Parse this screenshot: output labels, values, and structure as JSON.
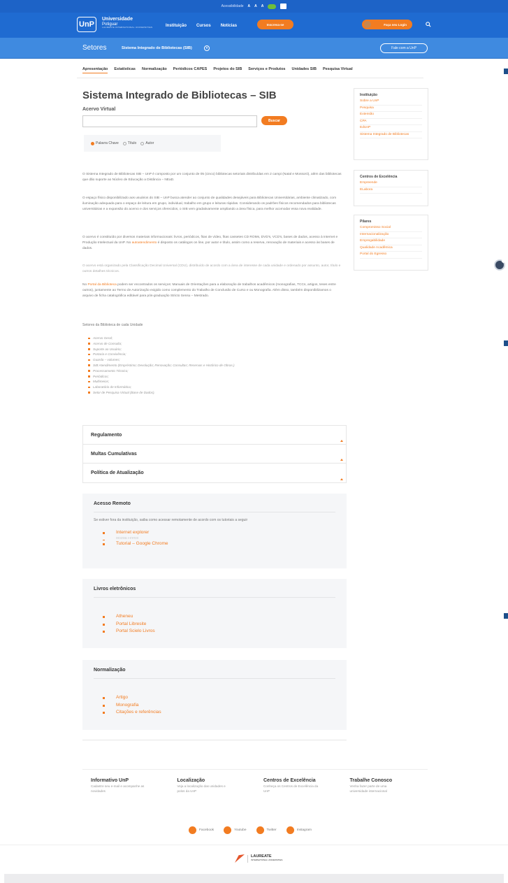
{
  "topbar": {
    "label": "Acessibilidade",
    "a1": "A",
    "a2": "A",
    "a3": "A"
  },
  "header": {
    "logo": "UnP",
    "univ1": "Universidade",
    "univ2": "Potiguar",
    "univ3": "LAUREATE INTERNATIONAL UNIVERSITIES",
    "nav": [
      "Instituição",
      "Cursos",
      "Notícias"
    ],
    "inscreva": "Inscreva-se",
    "login": "Faça seu Login"
  },
  "sectorbar": {
    "setores": "Setores",
    "current": "Sistema Integrado de Bibliotecas (SIB)",
    "fale": "Fale com a UnP"
  },
  "secnav": [
    "Apresentação",
    "Estatísticas",
    "Normalização",
    "Periódicos CAPES",
    "Projetos do SIB",
    "Serviços e Produtos",
    "Unidades SIB",
    "Pesquisa Virtual"
  ],
  "page": {
    "title": "Sistema Integrado de Bibliotecas – SIB",
    "acervo": "Acervo Virtual",
    "buscar": "Buscar",
    "radios": [
      "Palavra Chave",
      "Título",
      "Autor"
    ]
  },
  "sidebar": [
    {
      "title": "Instituição",
      "links": [
        "Sobre a UnP",
        "Pesquisa",
        "Extensão",
        "CPA",
        "EdUnP",
        "Sistema Integrado de Bibliotecas"
      ]
    },
    {
      "title": "Centros de Excelência",
      "links": [
        "Empreende",
        "ELabora"
      ]
    },
    {
      "title": "Pilares",
      "links": [
        "Compromisso Social",
        "Internacionalização",
        "Empregabilidade",
        "Qualidade Acadêmica",
        "Portal do Egresso"
      ]
    }
  ],
  "body": {
    "p1": "O Sistema Integrado de Bibliotecas SIB – UnP é composto por um conjunto de 05 (cinco) bibliotecas setoriais distribuídas em 2 campi (Natal e Mossoró), além das bibliotecas que dão suporte ao Núcleo de Educação a Distância – NEaD.",
    "p2": "O espaço físico disponibilizado aos usuários do SIB – UnP busca atender ao conjunto de qualidades desejáveis para Bibliotecas Universitárias, ambiente climatizado, com iluminação adequada para o espaço de leitura em grupo, individual, trabalho em grupo e leituras rápidas. Considerando os padrões físicos recomendados para bibliotecas universitárias e a expansão do acervo e dos serviços oferecidos, o SIB vem gradativamente ampliando a área física, para melhor acomodar essa nova realidade.",
    "p3a": "O acervo é constituído por diversos materiais informacionais: livros, periódicos, fitas de vídeo, fitas cassetes CD ROMs, DVD's, VCD's, bases de dados, acesso à Internet e Produção Intelectual da UnP. No ",
    "p3link": "autoatendimento",
    "p3b": " é disposto os catálogos on line, por autor e título, assim como a reserva, renovação de materiais e acesso às bases de dados.",
    "p4": "O acervo está organizado pela Classificação Decimal Universal (CDU), distribuído de acordo com a área de interesse de cada unidade e ordenado por assunto, autor, título e outros detalhes técnicos.",
    "p5a": "No ",
    "p5link": "Portal da Biblioteca",
    "p5b": " podem ser encontrados os serviços: Manuais de Orientações para a elaboração de trabalhos acadêmicos (monografias, TCCs, artigos, teses entre outros), juntamente ao Termo de Autorização exigido como complemento do Trabalho de Conclusão de Curso e ou Monografia. Além disso, também disponibilizamos o arquivo de ficha catalográfica editável para pós-graduação Stricto Sensu – Mestrado."
  },
  "setores": {
    "label": "Setores da Biblioteca de cada Unidade",
    "items": [
      "Acervo Geral;",
      "Acervo de Consulta;",
      "Suporte ao Usuário;",
      "Portaria e Convivência;",
      "Guarda – volumes;",
      "SIB Atendimento (Empréstimo; Devolução; Renovação; Consultas; Reservas e Histórico de Obras.)",
      "Processamento Técnico;",
      "Periódicos;",
      "Multimeios;",
      "Laboratório de Informática;",
      "Setor de Pesquisa Virtual (Base de Dados)."
    ]
  },
  "accordion": [
    "Regulamento",
    "Multas Cumulativas",
    "Política de Atualização"
  ],
  "remote": {
    "title": "Acesso Remoto",
    "text": "Se estiver fora da instituição, saiba como acessar remotamente de acordo com os tutoriais a seguir",
    "items": [
      "Internet explorer",
      "Mozilla Firefox",
      "Tutorial – Google Chrome"
    ]
  },
  "ebooks": {
    "title": "Livros eletrônicos",
    "items": [
      "Atheneu",
      "Portal Libresite",
      "Portal Scielo Livros"
    ]
  },
  "norm": {
    "title": "Normalização",
    "items": [
      "Artigo",
      "Monografia",
      "Citações e referências"
    ]
  },
  "footer": [
    {
      "title": "Informativo UnP",
      "text": "Cadastre seu e-mail e acompanhe as novidades"
    },
    {
      "title": "Localização",
      "text": "Veja a localização das unidades e polos da UnP"
    },
    {
      "title": "Centros de Excelência",
      "text": "Conheça os Centros de Excelência da UnP"
    },
    {
      "title": "Trabalhe Conosco",
      "text": "Venha fazer parte de uma universidade internacional"
    }
  ],
  "social": [
    "Facebook",
    "Youtube",
    "Twitter",
    "Instagram"
  ],
  "laureate": {
    "name": "LAUREATE",
    "sub": "INTERNATIONAL UNIVERSITIES"
  }
}
